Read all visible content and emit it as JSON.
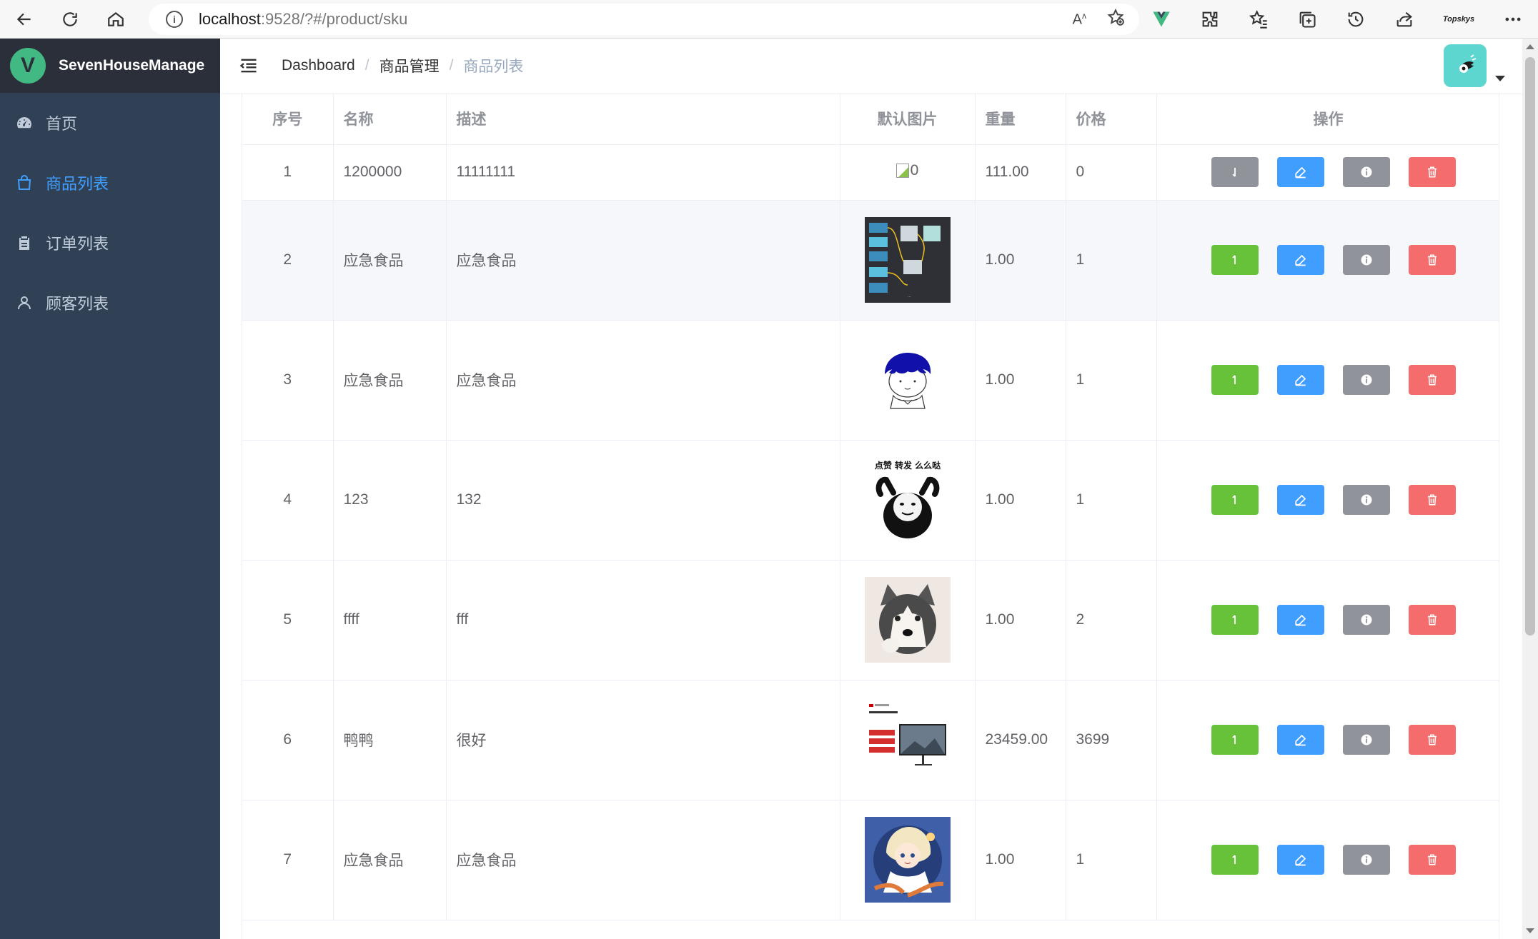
{
  "browser": {
    "url_host": "localhost",
    "url_path": ":9528/?#/product/sku",
    "profile_label": "Topskys"
  },
  "sidebar": {
    "app_title": "SevenHouseManage",
    "logo_letter": "V",
    "items": [
      {
        "label": "首页",
        "icon": "dashboard-icon"
      },
      {
        "label": "商品列表",
        "icon": "shopping-bag-icon",
        "active": true
      },
      {
        "label": "订单列表",
        "icon": "clipboard-icon"
      },
      {
        "label": "顾客列表",
        "icon": "user-icon"
      }
    ]
  },
  "breadcrumb": [
    "Dashboard",
    "商品管理",
    "商品列表"
  ],
  "table": {
    "headers": {
      "index": "序号",
      "name": "名称",
      "desc": "描述",
      "image": "默认图片",
      "weight": "重量",
      "price": "价格",
      "actions": "操作"
    },
    "rows": [
      {
        "index": "1",
        "name": "1200000",
        "desc": "11111111",
        "image": "broken",
        "image_alt": "0",
        "weight": "111.00",
        "price": "0",
        "status": "off"
      },
      {
        "index": "2",
        "name": "应急食品",
        "desc": "应急食品",
        "image": "diagram-screenshot",
        "weight": "1.00",
        "price": "1",
        "status": "on"
      },
      {
        "index": "3",
        "name": "应急食品",
        "desc": "应急食品",
        "image": "cartoon-boy",
        "weight": "1.00",
        "price": "1",
        "status": "on"
      },
      {
        "index": "4",
        "name": "123",
        "desc": "132",
        "image": "panda-meme",
        "image_caption": "点赞 转发 么么哒",
        "weight": "1.00",
        "price": "1",
        "status": "on"
      },
      {
        "index": "5",
        "name": "ffff",
        "desc": "fff",
        "image": "husky-photo",
        "weight": "1.00",
        "price": "2",
        "status": "on"
      },
      {
        "index": "6",
        "name": "鸭鸭",
        "desc": "很好",
        "image": "monitor-ad",
        "weight": "23459.00",
        "price": "3699",
        "status": "on"
      },
      {
        "index": "7",
        "name": "应急食品",
        "desc": "应急食品",
        "image": "anime-girl",
        "weight": "1.00",
        "price": "1",
        "status": "on"
      }
    ]
  },
  "colors": {
    "sidebar_bg": "#304156",
    "accent": "#409eff",
    "success": "#67c23a",
    "info": "#909399",
    "danger": "#f56c6c"
  }
}
